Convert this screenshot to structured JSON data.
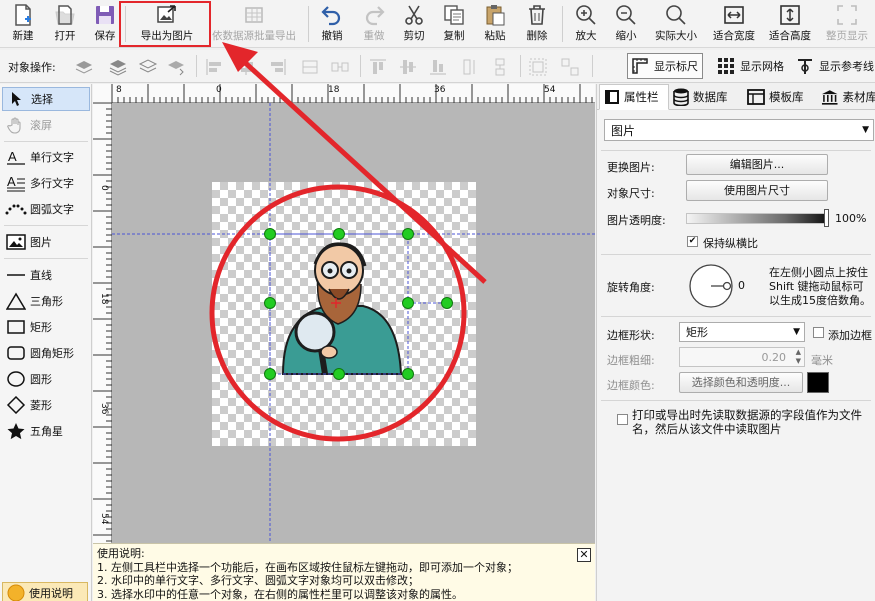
{
  "toolbar": {
    "new": "新建",
    "open": "打开",
    "save": "保存",
    "export_image": "导出为图片",
    "batch_export": "依数据源批量导出",
    "undo": "撤销",
    "redo": "重做",
    "cut": "剪切",
    "copy": "复制",
    "paste": "粘贴",
    "delete": "删除",
    "zoom_in": "放大",
    "zoom_out": "缩小",
    "actual_size": "实际大小",
    "fit_width": "适合宽度",
    "fit_height": "适合高度",
    "page_view": "整页显示"
  },
  "toolbar2": {
    "object_ops": "对象操作:",
    "show_ruler": "显示标尺",
    "show_grid": "显示网格",
    "show_guides": "显示参考线"
  },
  "tools": [
    {
      "label": "选择",
      "icon": "pointer-icon"
    },
    {
      "label": "滚屏",
      "icon": "hand-icon"
    },
    {
      "label": "单行文字",
      "icon": "single-line-text-icon"
    },
    {
      "label": "多行文字",
      "icon": "multi-line-text-icon"
    },
    {
      "label": "圆弧文字",
      "icon": "arc-text-icon"
    },
    {
      "label": "图片",
      "icon": "picture-icon"
    },
    {
      "label": "直线",
      "icon": "line-icon"
    },
    {
      "label": "三角形",
      "icon": "triangle-icon"
    },
    {
      "label": "矩形",
      "icon": "rectangle-icon"
    },
    {
      "label": "圆角矩形",
      "icon": "rounded-rectangle-icon"
    },
    {
      "label": "圆形",
      "icon": "circle-icon"
    },
    {
      "label": "菱形",
      "icon": "diamond-icon"
    },
    {
      "label": "五角星",
      "icon": "star-icon"
    }
  ],
  "help_button": "使用说明",
  "ruler": {
    "top": [
      "8",
      "0",
      "18",
      "36",
      "54"
    ],
    "left": [
      "0",
      "18",
      "36",
      "54"
    ]
  },
  "help": {
    "title": "使用说明:",
    "lines": [
      "1. 左侧工具栏中选择一个功能后，在画布区域按住鼠标左键拖动，即可添加一个对象；",
      "2. 水印中的单行文字、多行文字、圆弧文字对象均可以双击修改；",
      "3. 选择水印中的任意一个对象，在右侧的属性栏里可以调整该对象的属性。"
    ],
    "close": "✕"
  },
  "right": {
    "tabs": [
      "属性栏",
      "数据库",
      "模板库",
      "素材库"
    ],
    "object_type": "图片",
    "replace_label": "更换图片:",
    "edit_button": "编辑图片...",
    "size_label": "对象尺寸:",
    "size_button": "使用图片尺寸",
    "opacity_label": "图片透明度:",
    "opacity_value": "100%",
    "keep_ratio": "保持纵横比",
    "rotation_label": "旋转角度:",
    "rotation_value": "0",
    "rotation_hint": [
      "在左侧小圆点上按住",
      "Shift 键拖动鼠标可",
      "以生成15度倍数角。"
    ],
    "border_shape_label": "边框形状:",
    "border_shape_value": "矩形",
    "add_border": "添加边框",
    "border_width_label": "边框粗细:",
    "border_width_value": "0.20",
    "border_width_unit": "毫米",
    "border_color_label": "边框颜色:",
    "border_color_button": "选择颜色和透明度...",
    "border_color": "#000000",
    "datasource_note": [
      "打印或导出时先读取数据源的字段值作为文件",
      "名，然后从该文件中读取图片"
    ]
  },
  "colors": {
    "annotation_red": "#e3262b",
    "handle_green": "#22cc22",
    "guide_blue": "#4b55d6",
    "character_teal": "#3a9c94"
  }
}
